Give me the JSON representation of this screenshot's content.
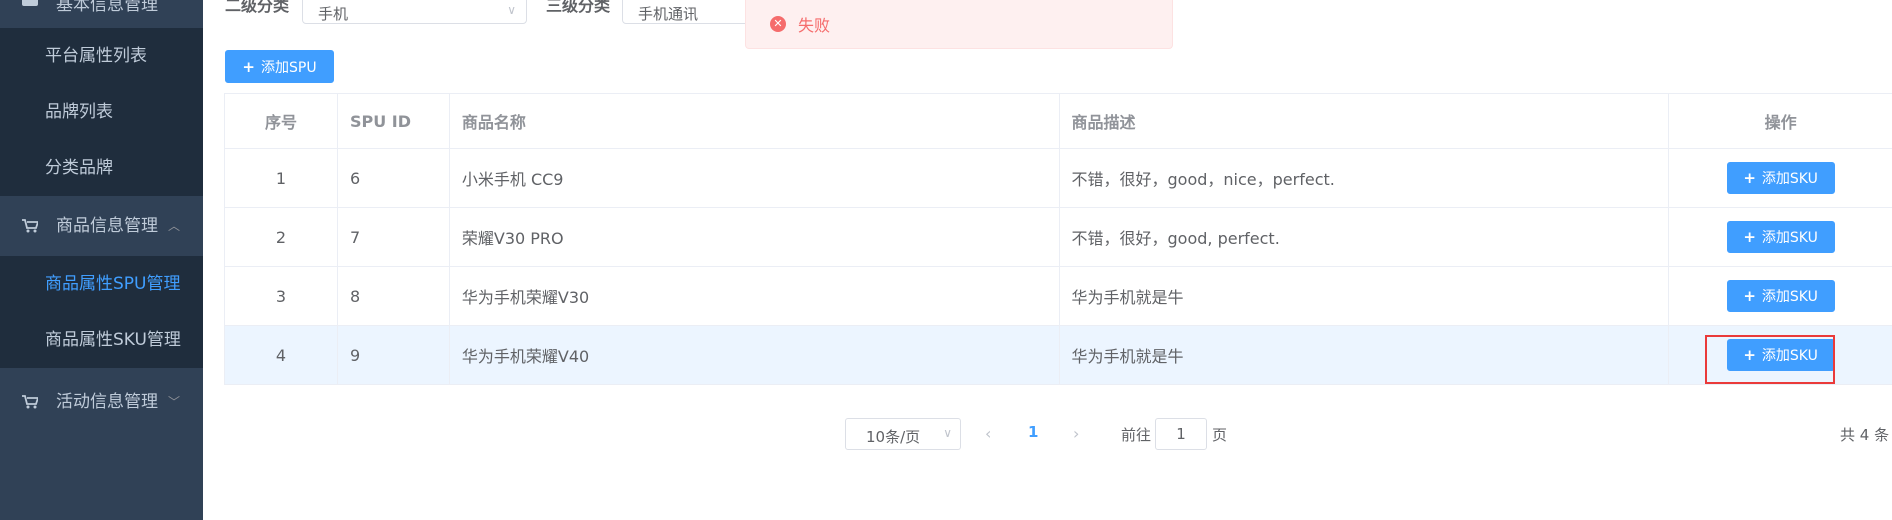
{
  "sidebar": {
    "top_partial": "基本信息管理",
    "items": [
      {
        "label": "平台属性列表"
      },
      {
        "label": "品牌列表"
      },
      {
        "label": "分类品牌"
      }
    ],
    "groups": [
      {
        "label": "商品信息管理"
      },
      {
        "label": "活动信息管理"
      }
    ],
    "sub_items": [
      {
        "label": "商品属性SPU管理"
      },
      {
        "label": "商品属性SKU管理"
      }
    ]
  },
  "filter": {
    "level2_label": "二级分类",
    "level2_value": "手机",
    "level3_label": "三级分类",
    "level3_value": "手机通讯"
  },
  "alert": {
    "message": "失败"
  },
  "toolbar": {
    "add_spu_label": "添加SPU"
  },
  "table": {
    "headers": {
      "index": "序号",
      "spu_id": "SPU ID",
      "name": "商品名称",
      "desc": "商品描述",
      "action": "操作"
    },
    "rows": [
      {
        "index": "1",
        "spu_id": "6",
        "name": "小米手机 CC9",
        "desc": "不错，很好，good，nice，perfect.",
        "action": "添加SKU"
      },
      {
        "index": "2",
        "spu_id": "7",
        "name": "荣耀V30 PRO",
        "desc": "不错，很好，good, perfect.",
        "action": "添加SKU"
      },
      {
        "index": "3",
        "spu_id": "8",
        "name": "华为手机荣耀V30",
        "desc": "华为手机就是牛",
        "action": "添加SKU"
      },
      {
        "index": "4",
        "spu_id": "9",
        "name": "华为手机荣耀V40",
        "desc": "华为手机就是牛",
        "action": "添加SKU"
      }
    ]
  },
  "pagination": {
    "page_size": "10条/页",
    "current_page": "1",
    "goto_label": "前往",
    "goto_value": "1",
    "page_suffix": "页",
    "total": "共 4 条"
  },
  "colors": {
    "primary": "#409eff",
    "sidebar": "#304156",
    "danger": "#f56c6c",
    "highlight_box": "#ea3a3a"
  }
}
